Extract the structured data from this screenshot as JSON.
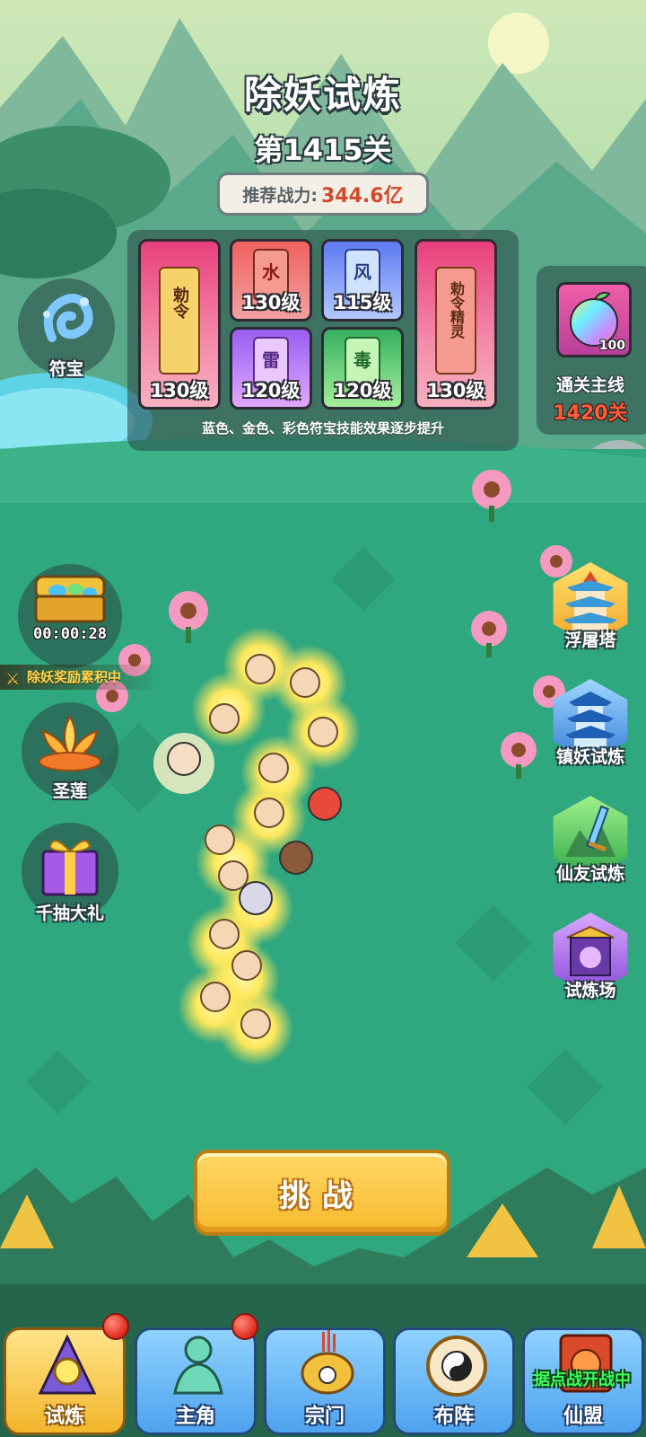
{
  "header": {
    "title": "除妖试炼",
    "stage": "第1415关",
    "power_label": "推荐战力:",
    "power_value": "344.6亿"
  },
  "talismans": {
    "cards": [
      {
        "level": "130级",
        "glyph": "勅令",
        "color": "#e8407c"
      },
      {
        "level": "130级",
        "glyph": "水",
        "color": "#f06060"
      },
      {
        "level": "115级",
        "glyph": "风",
        "color": "#5e7af1"
      },
      {
        "level": "130级",
        "glyph": "勅令精灵",
        "color": "#e8407c"
      },
      {
        "level": "120级",
        "glyph": "雷",
        "color": "#9a5ef1"
      },
      {
        "level": "120级",
        "glyph": "毒",
        "color": "#36b060"
      }
    ],
    "note": "蓝色、金色、彩色符宝技能效果逐步提升"
  },
  "mainline": {
    "item_count": "100",
    "label": "通关主线",
    "stage": "1420关"
  },
  "left_buttons": {
    "talisman": "符宝",
    "timer": "00:00:28",
    "accumulating": "除妖奖励累积中",
    "lotus": "圣莲",
    "gift": "千抽大礼"
  },
  "right_buttons": {
    "tower": "浮屠塔",
    "demon_trial": "镇妖试炼",
    "friend_trial": "仙友试炼",
    "arena": "试炼场"
  },
  "challenge": "挑战",
  "nav": {
    "items": [
      {
        "label": "试炼",
        "active": true,
        "badge": true
      },
      {
        "label": "主角",
        "active": false,
        "badge": true
      },
      {
        "label": "宗门",
        "active": false,
        "badge": false
      },
      {
        "label": "布阵",
        "active": false,
        "badge": false
      },
      {
        "label": "仙盟",
        "active": false,
        "badge": false
      }
    ],
    "alliance_banner": "据点战开战中"
  },
  "colors": {
    "ground": "#2fa77f",
    "accent_gold": "#f6b92d",
    "alert_red": "#ff5c3d"
  }
}
